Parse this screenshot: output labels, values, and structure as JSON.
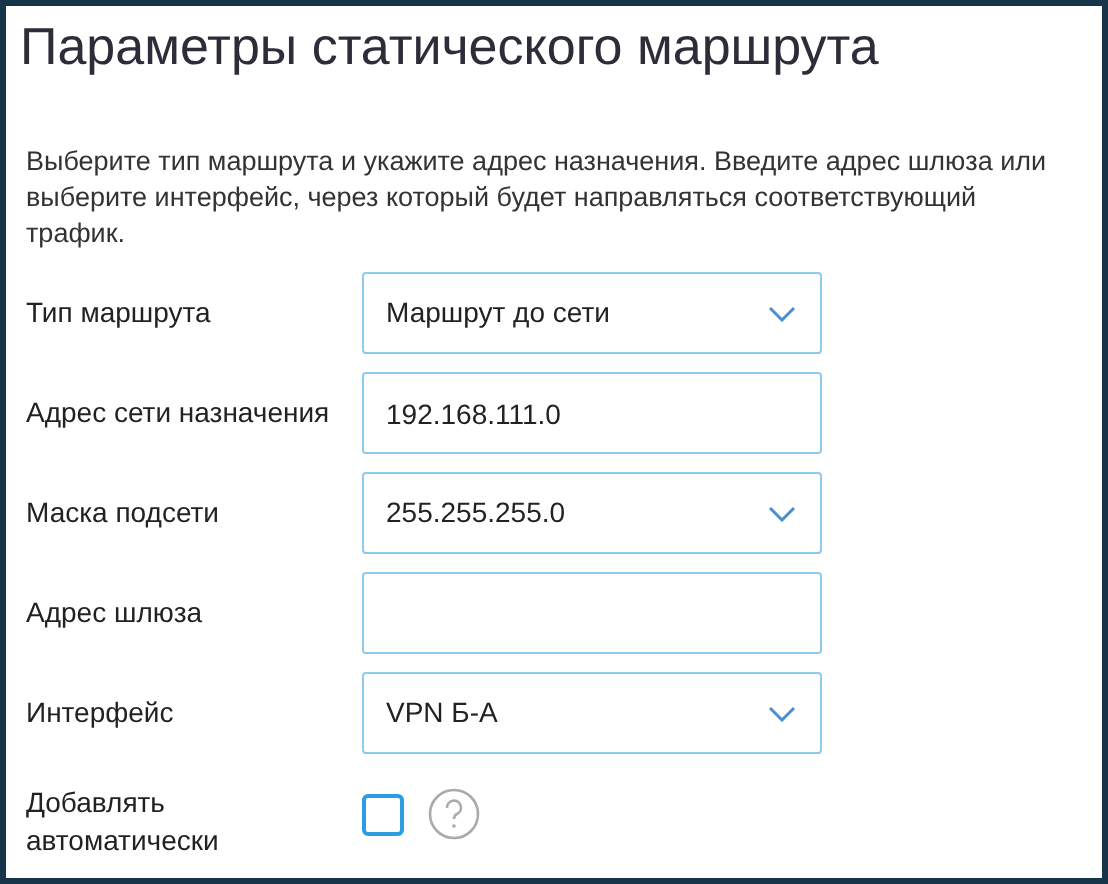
{
  "title": "Параметры статического маршрута",
  "description": "Выберите тип маршрута и укажите адрес назначения. Введите адрес шлюза или выберите интерфейс, через который будет направляться соответствующий трафик.",
  "fields": [
    {
      "label": "Тип маршрута",
      "kind": "select",
      "value": "Маршрут до сети"
    },
    {
      "label": "Адрес сети назначения",
      "kind": "input",
      "value": "192.168.111.0"
    },
    {
      "label": "Маска подсети",
      "kind": "select",
      "value": "255.255.255.0"
    },
    {
      "label": "Адрес шлюза",
      "kind": "input"
    },
    {
      "label": "Интерфейс",
      "kind": "select",
      "value": "VPN Б-А"
    },
    {
      "label": "Добавлять автоматически",
      "kind": "checkbox",
      "checked": false
    }
  ]
}
